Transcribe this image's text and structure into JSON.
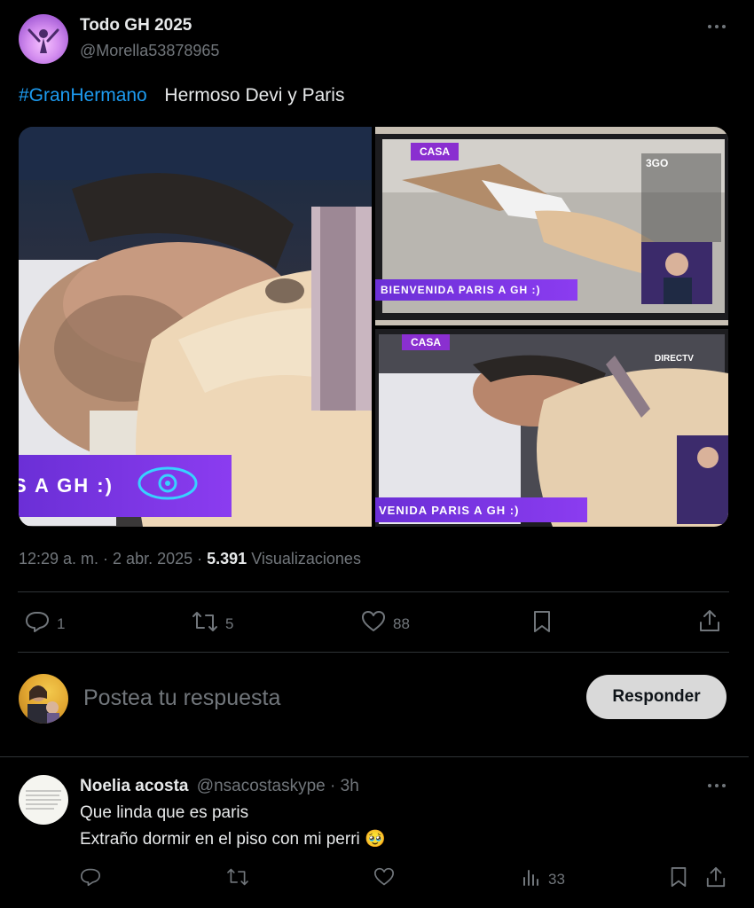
{
  "post": {
    "display_name": "Todo GH 2025",
    "handle": "@Morella53878965",
    "hashtag": "#GranHermano",
    "text": "Hermoso Devi y Paris",
    "timestamp": "12:29 a. m. · 2 abr. 2025 ·",
    "views_count": "5.391",
    "views_label": "Visualizaciones",
    "replies": "1",
    "reposts": "5",
    "likes": "88",
    "media": {
      "left_overlay": "S A GH :)",
      "top_right_overlay": "BIENVENIDA PARIS A GH :)",
      "bottom_right_overlay": "VENIDA PARIS A GH :)",
      "tv_brand_top": "DIRECTV",
      "casa_label": "CASA",
      "channel_logo": "3GO"
    }
  },
  "composer": {
    "placeholder": "Postea tu respuesta",
    "button_label": "Responder"
  },
  "reply": {
    "display_name": "Noelia acosta",
    "handle": "@nsacostaskype",
    "time": "· 3h",
    "line1": "Que linda que es paris",
    "line2": "Extraño dormir en el piso con mi perri",
    "emoji": "🥹",
    "views": "33"
  },
  "colors": {
    "accent": "#1d9bf0",
    "muted": "#71767b",
    "overlay_purple": "#7b35e8"
  }
}
